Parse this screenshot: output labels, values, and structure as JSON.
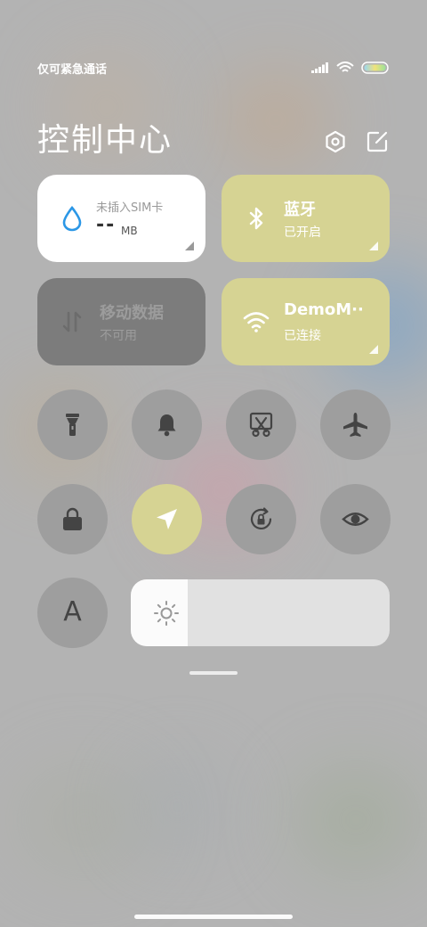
{
  "status_bar": {
    "carrier": "仅可紧急通话"
  },
  "header": {
    "title": "控制中心"
  },
  "tiles": {
    "data_usage": {
      "label": "未插入SIM卡",
      "value": "--",
      "unit": "MB"
    },
    "bluetooth": {
      "title": "蓝牙",
      "status": "已开启"
    },
    "mobile_data": {
      "title": "移动数据",
      "status": "不可用"
    },
    "wifi": {
      "title": "DemoM··",
      "status": "已连接"
    }
  },
  "toggles": [
    {
      "name": "flashlight",
      "active": false
    },
    {
      "name": "mute",
      "active": false
    },
    {
      "name": "screenshot",
      "active": false
    },
    {
      "name": "airplane-mode",
      "active": false
    },
    {
      "name": "lock-screen",
      "active": false
    },
    {
      "name": "location",
      "active": true
    },
    {
      "name": "rotation-lock",
      "active": false
    },
    {
      "name": "reading-mode",
      "active": false
    },
    {
      "name": "auto-text",
      "label": "A",
      "active": false
    }
  ],
  "brightness": {
    "level": 0.22
  },
  "colors": {
    "accent": "#d6d393",
    "tile_white": "#ffffff",
    "tile_disabled": "#7c7c7c",
    "circle": "#9e9e9e"
  }
}
